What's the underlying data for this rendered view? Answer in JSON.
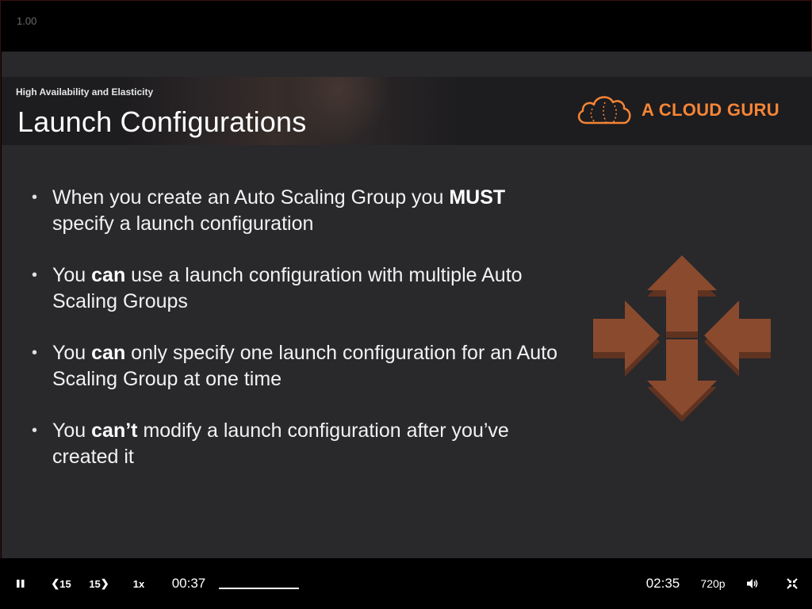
{
  "player": {
    "speed_readout": "1.00"
  },
  "slide": {
    "subtitle": "High Availability and Elasticity",
    "title": "Launch Configurations",
    "brand": "A CLOUD GURU",
    "bullets": [
      {
        "pre": "When you create an Auto Scaling Group you ",
        "bold": "MUST",
        "post": " specify a launch configuration"
      },
      {
        "pre": "You ",
        "bold": "can",
        "post": " use a launch configuration with multiple Auto Scaling Groups"
      },
      {
        "pre": "You ",
        "bold": "can",
        "post": " only specify one launch configuration for an Auto Scaling Group at one time"
      },
      {
        "pre": "You ",
        "bold": "can’t",
        "post": " modify a launch configuration after you’ve created it"
      }
    ],
    "bullet_marker": "•",
    "graphic_icon": "auto-scaling-arrows-icon"
  },
  "controls": {
    "skip_back_label": "15",
    "skip_forward_label": "15",
    "speed_label": "1x",
    "current_time": "00:37",
    "duration": "02:35",
    "quality": "720p",
    "progress_fraction": 0.25,
    "icons": {
      "pause": "pause-icon",
      "volume": "volume-icon",
      "exit_fullscreen": "exit-fullscreen-icon"
    }
  },
  "colors": {
    "brand_orange": "#f58536",
    "arrow_fill": "#8a4a2e",
    "arrow_shadow": "#5f3320",
    "slide_bg": "#29282b",
    "header_bg": "#1d1c1f"
  }
}
